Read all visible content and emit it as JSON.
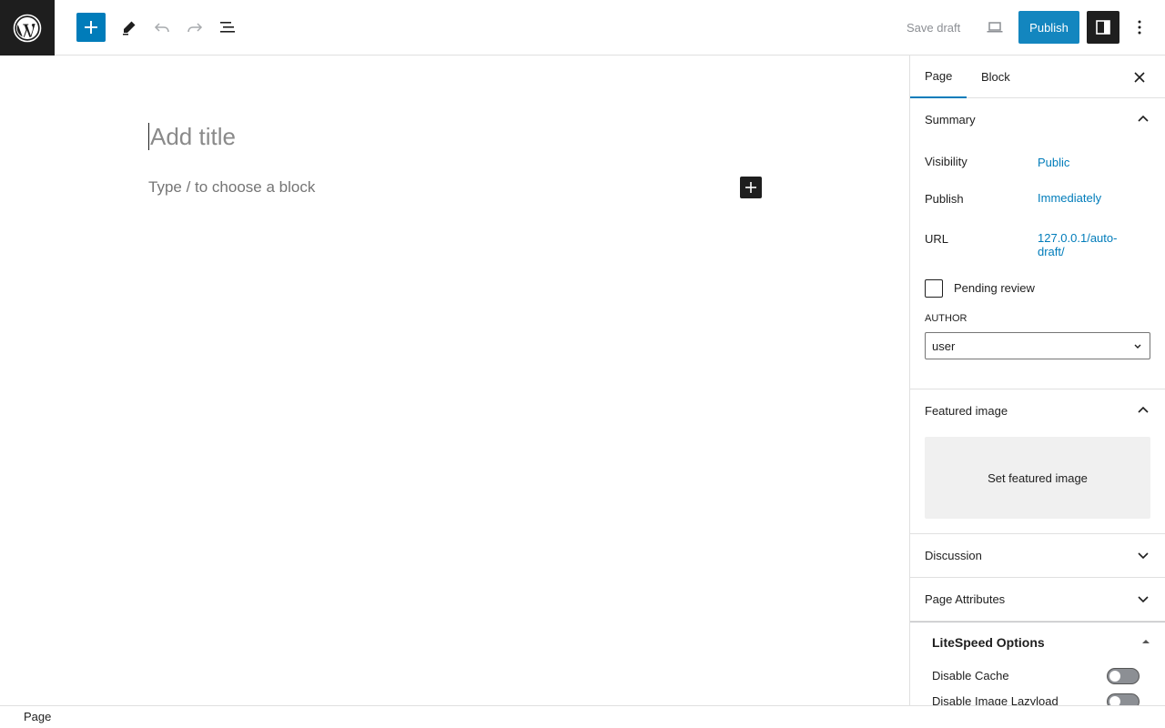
{
  "toolbar": {
    "logo_icon": "wordpress-logo-icon",
    "add_block_icon": "plus-icon",
    "tools_icon": "pencil-icon",
    "undo_icon": "undo-icon",
    "redo_icon": "redo-icon",
    "list_view_icon": "list-view-icon",
    "save_draft_label": "Save draft",
    "preview_icon": "laptop-icon",
    "publish_label": "Publish",
    "settings_icon": "sidebar-toggle-icon",
    "more_icon": "vertical-ellipsis-icon",
    "accent_color": "#007cba"
  },
  "editor": {
    "title_placeholder": "Add title",
    "block_placeholder": "Type / to choose a block",
    "inline_add_icon": "plus-icon"
  },
  "sidebar": {
    "tabs": [
      {
        "label": "Page",
        "active": true
      },
      {
        "label": "Block",
        "active": false
      }
    ],
    "close_icon": "close-icon",
    "summary": {
      "title": "Summary",
      "visibility_label": "Visibility",
      "visibility_value": "Public",
      "publish_label": "Publish",
      "publish_value": "Immediately",
      "url_label": "URL",
      "url_value": "127.0.0.1/auto-draft/",
      "pending_review_label": "Pending review",
      "author_label": "AUTHOR",
      "author_value": "user"
    },
    "featured_image": {
      "title": "Featured image",
      "button_label": "Set featured image"
    },
    "discussion": {
      "title": "Discussion"
    },
    "page_attributes": {
      "title": "Page Attributes"
    },
    "litespeed": {
      "title": "LiteSpeed Options",
      "options": [
        {
          "label": "Disable Cache",
          "enabled": false
        },
        {
          "label": "Disable Image Lazyload",
          "enabled": false
        }
      ]
    }
  },
  "footer": {
    "breadcrumb": "Page"
  }
}
